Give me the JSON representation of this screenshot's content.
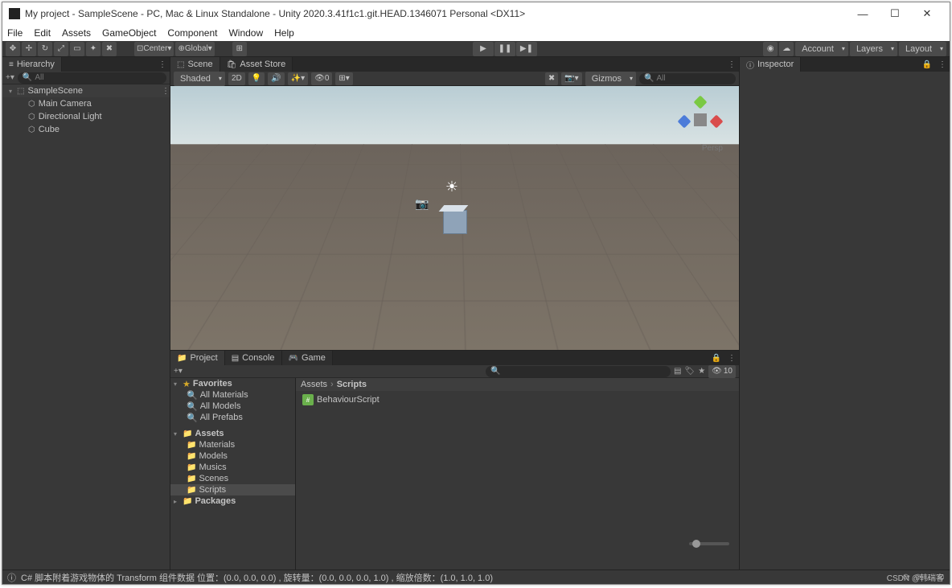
{
  "title": "My project - SampleScene - PC, Mac & Linux Standalone - Unity 2020.3.41f1c1.git.HEAD.1346071 Personal <DX11>",
  "menu": [
    "File",
    "Edit",
    "Assets",
    "GameObject",
    "Component",
    "Window",
    "Help"
  ],
  "toolbar": {
    "center_label": "Center",
    "global_label": "Global",
    "account": "Account",
    "layers": "Layers",
    "layout": "Layout"
  },
  "hierarchy": {
    "title": "Hierarchy",
    "search_placeholder": "All",
    "scene": "SampleScene",
    "items": [
      "Main Camera",
      "Directional Light",
      "Cube"
    ]
  },
  "scene_tab": {
    "scene": "Scene",
    "asset_store": "Asset Store"
  },
  "scene_tools": {
    "shaded": "Shaded",
    "mode_2d": "2D",
    "gizmos": "Gizmos",
    "search_placeholder": "All",
    "persp": "Persp"
  },
  "inspector": {
    "title": "Inspector"
  },
  "project": {
    "tabs": {
      "project": "Project",
      "console": "Console",
      "game": "Game"
    },
    "visible_count": "10",
    "favorites": "Favorites",
    "fav_items": [
      "All Materials",
      "All Models",
      "All Prefabs"
    ],
    "assets": "Assets",
    "folders": [
      "Materials",
      "Models",
      "Musics",
      "Scenes",
      "Scripts"
    ],
    "packages": "Packages",
    "breadcrumb": [
      "Assets",
      "Scripts"
    ],
    "asset_name": "BehaviourScript"
  },
  "status": {
    "message": "C# 脚本附着游戏物体的 Transform 组件数据 位置：(0.0, 0.0, 0.0) , 旋转量：(0.0, 0.0, 0.0, 1.0) , 缩放倍数：(1.0, 1.0, 1.0)"
  },
  "watermark": "CSDN @韩瑞客"
}
